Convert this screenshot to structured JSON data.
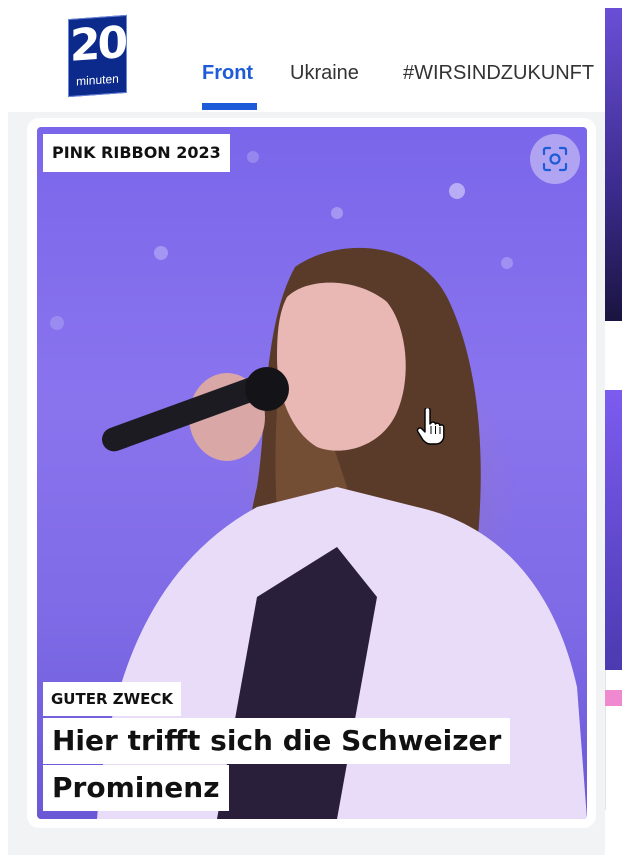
{
  "header": {
    "logo": {
      "number": "20",
      "word": "minuten",
      "color": "#0b2a8c"
    },
    "tabs": [
      {
        "label": "Front",
        "active": true
      },
      {
        "label": "Ukraine",
        "active": false
      },
      {
        "label": "#WIRSINDZUKUNFT",
        "active": false
      }
    ],
    "accent_color": "#1d5bd8"
  },
  "article": {
    "topic": "PINK RIBBON 2023",
    "kicker": "GUTER ZWECK",
    "headline_lines": [
      "Hier trifft sich die Schweizer",
      "Prominenz"
    ],
    "zoom_icon": "image-zoom-icon"
  },
  "cursor": "hand-pointer-icon"
}
